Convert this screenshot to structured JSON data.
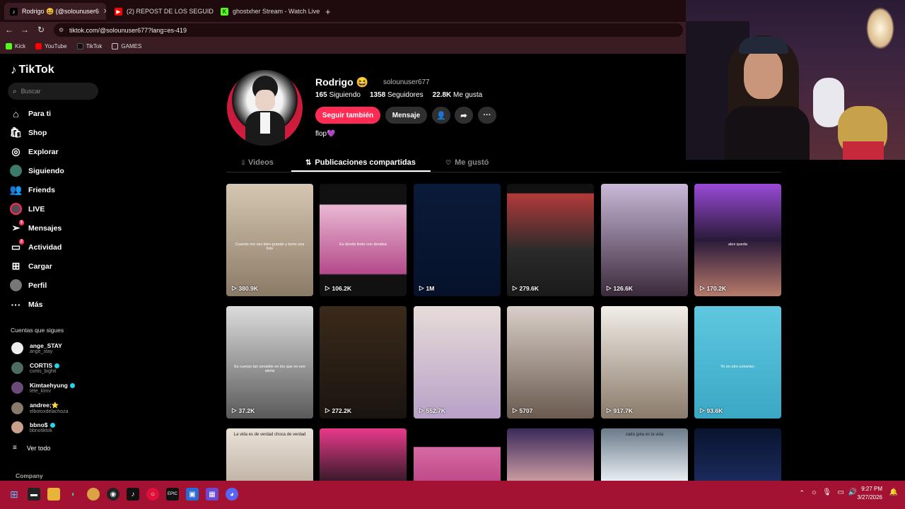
{
  "browser": {
    "tabs": [
      {
        "title": "Rodrigo 😆 (@solounuser6",
        "active": true,
        "close": "✕"
      },
      {
        "title": "(2) REPOST DE LOS SEGUIDOR",
        "active": false,
        "close": "✕"
      },
      {
        "title": "ghostxher Stream - Watch Live",
        "active": false,
        "close": "✕"
      }
    ],
    "new_tab": "+",
    "url": "tiktok.com/@solounuser677?lang=es-419",
    "bookmarks": [
      "Kick",
      "YouTube",
      "TikTok",
      "GAMES"
    ]
  },
  "sidebar": {
    "logo": "TikTok",
    "search_placeholder": "Buscar",
    "nav": [
      {
        "label": "Para ti",
        "icon": "home-icon"
      },
      {
        "label": "Shop",
        "icon": "shop-icon"
      },
      {
        "label": "Explorar",
        "icon": "compass-icon"
      },
      {
        "label": "Siguiendo",
        "icon": "following-icon"
      },
      {
        "label": "Friends",
        "icon": "friends-icon"
      },
      {
        "label": "LIVE",
        "icon": "live-icon"
      },
      {
        "label": "Mensajes",
        "icon": "messages-icon",
        "badge": "3"
      },
      {
        "label": "Actividad",
        "icon": "activity-icon",
        "badge": "2"
      },
      {
        "label": "Cargar",
        "icon": "upload-icon"
      },
      {
        "label": "Perfil",
        "icon": "profile-icon"
      },
      {
        "label": "Más",
        "icon": "more-icon"
      }
    ],
    "following_title": "Cuentas que sigues",
    "following": [
      {
        "name": "ange_STAY",
        "handle": "ange_stay",
        "verified": false
      },
      {
        "name": "CORTIS",
        "handle": "cortis_bighit",
        "verified": true
      },
      {
        "name": "Kimtaehyung",
        "handle": "tete_kimv",
        "verified": true
      },
      {
        "name": "andree;⭐",
        "handle": "elbotoxdelachoza",
        "verified": false
      },
      {
        "name": "bbno$",
        "handle": "bbnotiktok",
        "verified": true
      }
    ],
    "see_all": "Ver todo",
    "company": "Company"
  },
  "profile": {
    "name": "Rodrigo 😆",
    "handle": "solounuser677",
    "following_count": "165",
    "following_label": "Siguiendo",
    "followers_count": "1358",
    "followers_label": "Seguidores",
    "likes_count": "22.8K",
    "likes_label": "Me gusta",
    "follow_back": "Seguir también",
    "message": "Mensaje",
    "bio": "flop💜"
  },
  "profile_tabs": {
    "videos": "Videos",
    "reposts": "Publicaciones compartidas",
    "liked": "Me gustó"
  },
  "videos": [
    {
      "views": "380.9K",
      "caption": "Cuando me ves bien grande y tomo una foto"
    },
    {
      "views": "106.2K",
      "caption": "Es donde lindo con dondea"
    },
    {
      "views": "1M",
      "caption": ""
    },
    {
      "views": "279.6K",
      "caption": ""
    },
    {
      "views": "126.6K",
      "caption": ""
    },
    {
      "views": "170.2K",
      "caption": "alex queda"
    },
    {
      "views": "37.2K",
      "caption": "Es cuerpo tan sensible en los que no son alerta"
    },
    {
      "views": "272.2K",
      "caption": ""
    },
    {
      "views": "552.7K",
      "caption": ""
    },
    {
      "views": "5707",
      "caption": ""
    },
    {
      "views": "917.7K",
      "caption": ""
    },
    {
      "views": "93.6K",
      "caption": "Yo en otro universo:"
    },
    {
      "views": "",
      "caption": "La vida es de verdad choca de verdad"
    },
    {
      "views": "",
      "caption": ""
    },
    {
      "views": "",
      "caption": ""
    },
    {
      "views": "",
      "caption": ""
    },
    {
      "views": "",
      "caption": "cada gota es la vida"
    },
    {
      "views": "",
      "caption": ""
    }
  ],
  "taskbar": {
    "time": "9:27 PM",
    "date": "3/27/2026"
  },
  "colors": {
    "accent": "#fe2c55",
    "tab_bg": "#1f0a0d",
    "toolbar_bg": "#3a1d22",
    "taskbar_bg": "#a31232"
  }
}
